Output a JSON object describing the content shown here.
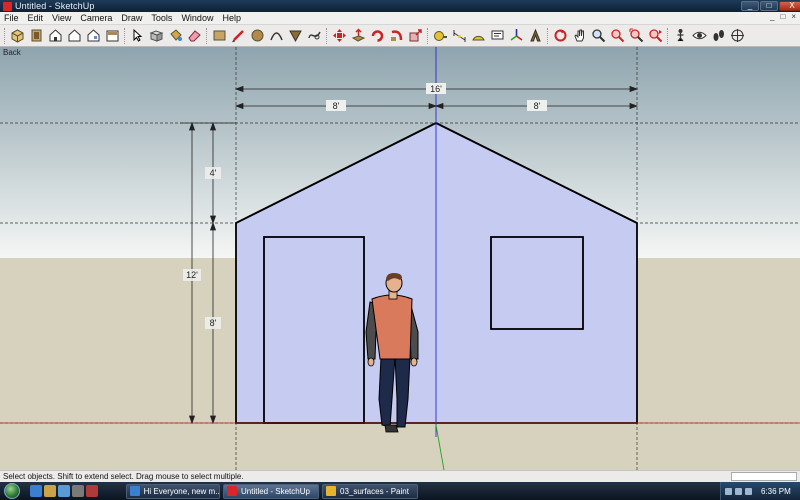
{
  "window": {
    "title": "Untitled - SketchUp",
    "controls": [
      "_",
      "□",
      "X"
    ],
    "mdi_controls": [
      "_",
      "□",
      "×"
    ]
  },
  "menu": [
    "File",
    "Edit",
    "View",
    "Camera",
    "Draw",
    "Tools",
    "Window",
    "Help"
  ],
  "toolbar": {
    "icons": [
      "iso-view-icon",
      "top-view-icon",
      "front-view-icon",
      "right-view-icon",
      "back-view-icon",
      "left-view-icon",
      "select-arrow-icon",
      "make-component-icon",
      "paint-bucket-icon",
      "eraser-icon",
      "rectangle-icon",
      "line-pencil-icon",
      "circle-icon",
      "arc-icon",
      "polygon-icon",
      "freehand-icon",
      "move-icon",
      "push-pull-icon",
      "rotate-icon",
      "follow-me-icon",
      "scale-icon",
      "tape-measure-icon",
      "dimension-icon",
      "protractor-icon",
      "text-icon",
      "axes-icon",
      "3d-text-icon",
      "orbit-icon",
      "pan-icon",
      "zoom-icon",
      "zoom-window-icon",
      "zoom-extents-icon",
      "previous-view-icon",
      "position-camera-icon",
      "look-around-icon",
      "walk-icon",
      "section-plane-icon"
    ]
  },
  "viewport": {
    "view_label": "Back",
    "dimensions": {
      "total_width": "16'",
      "left_half": "8'",
      "right_half": "8'",
      "total_height": "12'",
      "roof_height": "4'",
      "wall_height": "8'"
    },
    "colors": {
      "sky_top": "#8ea4ae",
      "sky_bottom": "#f4f6f4",
      "ground": "#d7d2bd",
      "wall_fill": "#c6cbf2",
      "wall_stroke": "#000000",
      "axis_blue": "#2727d8",
      "axis_green": "#21a321",
      "axis_red": "#b21f1f"
    }
  },
  "status": {
    "text": "Select objects. Shift to extend select. Drag mouse to select multiple."
  },
  "taskbar": {
    "tasks": [
      {
        "label": "Hi Everyone, new m...",
        "active": false
      },
      {
        "label": "Untitled - SketchUp",
        "active": true
      },
      {
        "label": "03_surfaces - Paint",
        "active": false
      }
    ],
    "clock": "6:36 PM"
  }
}
